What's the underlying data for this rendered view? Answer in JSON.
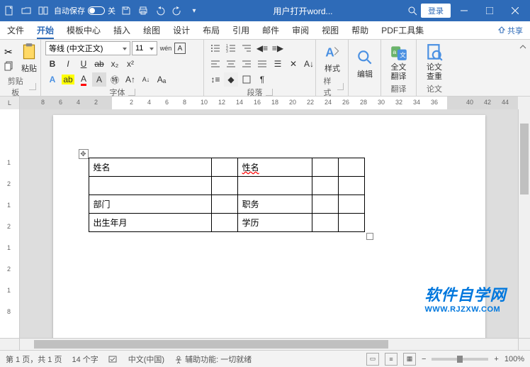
{
  "titlebar": {
    "autosave_label": "自动保存",
    "autosave_state": "关",
    "title": "用户打开word...",
    "login_label": "登录"
  },
  "tabs": {
    "items": [
      "文件",
      "开始",
      "模板中心",
      "插入",
      "绘图",
      "设计",
      "布局",
      "引用",
      "邮件",
      "审阅",
      "视图",
      "帮助",
      "PDF工具集"
    ],
    "active_index": 1,
    "share_label": "共享"
  },
  "ribbon": {
    "clipboard": {
      "label": "剪贴板",
      "paste": "粘贴"
    },
    "font": {
      "label": "字体",
      "family": "等线 (中文正文)",
      "size": "11",
      "wen": "wén",
      "bold": "B",
      "italic": "I",
      "underline": "U"
    },
    "paragraph": {
      "label": "段落"
    },
    "styles": {
      "label": "样式",
      "btn": "样式"
    },
    "editing": {
      "label": "编辑"
    },
    "translate": {
      "label": "翻译",
      "btn": "全文翻译"
    },
    "thesis": {
      "label": "论文",
      "btn": "论文查重"
    }
  },
  "ruler": {
    "h_ticks": [
      "8",
      "6",
      "4",
      "2",
      "2",
      "4",
      "6",
      "8",
      "10",
      "12",
      "14",
      "16",
      "18",
      "20",
      "22",
      "24",
      "26",
      "28",
      "30",
      "32",
      "34",
      "36",
      "40",
      "42",
      "44"
    ]
  },
  "document": {
    "table": {
      "rows": [
        [
          "姓名",
          "",
          "性名",
          "",
          ""
        ],
        [
          "",
          "",
          "",
          "",
          ""
        ],
        [
          "部门",
          "",
          "职务",
          "",
          ""
        ],
        [
          "出生年月",
          "",
          "学历",
          "",
          ""
        ]
      ]
    }
  },
  "watermark": {
    "cn": "软件自学网",
    "en": "WWW.RJZXW.COM"
  },
  "statusbar": {
    "page": "第 1 页，共 1 页",
    "words": "14 个字",
    "lang": "中文(中国)",
    "accessibility": "辅助功能: 一切就绪",
    "zoom": "100%"
  }
}
